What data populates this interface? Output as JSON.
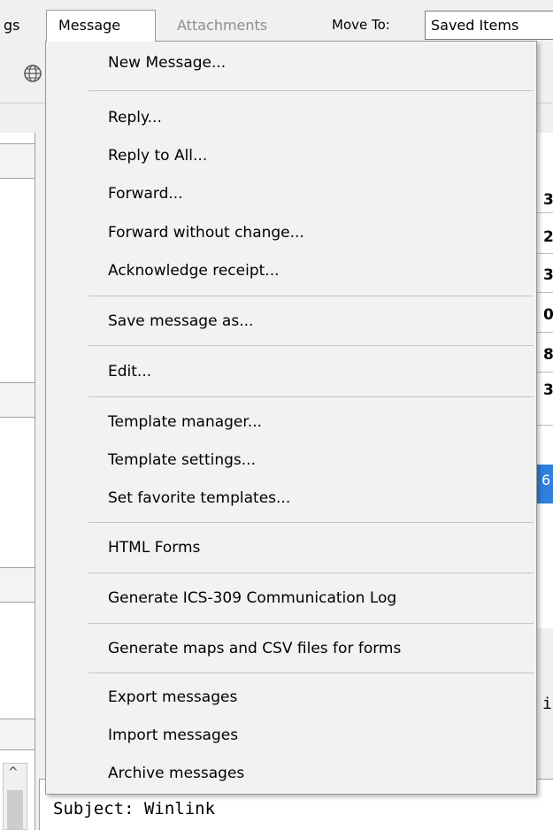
{
  "menubar": {
    "partial_left": "gs",
    "message": "Message",
    "attachments": "Attachments",
    "move_to": "Move To:",
    "move_to_value": "Saved Items"
  },
  "message_menu": {
    "items": [
      "New Message...",
      "Reply...",
      "Reply to All...",
      "Forward...",
      "Forward without change...",
      "Acknowledge receipt...",
      "Save message as...",
      "Edit...",
      "Template manager...",
      "Template settings...",
      "Set favorite templates...",
      "HTML Forms",
      "Generate ICS-309 Communication Log",
      "Generate maps and CSV files for forms",
      "Export messages",
      "Import messages",
      "Archive messages"
    ]
  },
  "message_list": {
    "partial_digits": [
      "3",
      "2",
      "3",
      "0",
      "8",
      "3"
    ],
    "selected_partial_digit": "6"
  },
  "preview": {
    "subject": "Subject: Winlink",
    "partial_right": "i"
  },
  "icons": {
    "globe": "globe-icon",
    "scroll_up": "chevron-up-icon"
  },
  "colors": {
    "selection": "#2f7fdc",
    "menu_bg": "#f2f2f2",
    "disabled_text": "#8e8e8e"
  }
}
